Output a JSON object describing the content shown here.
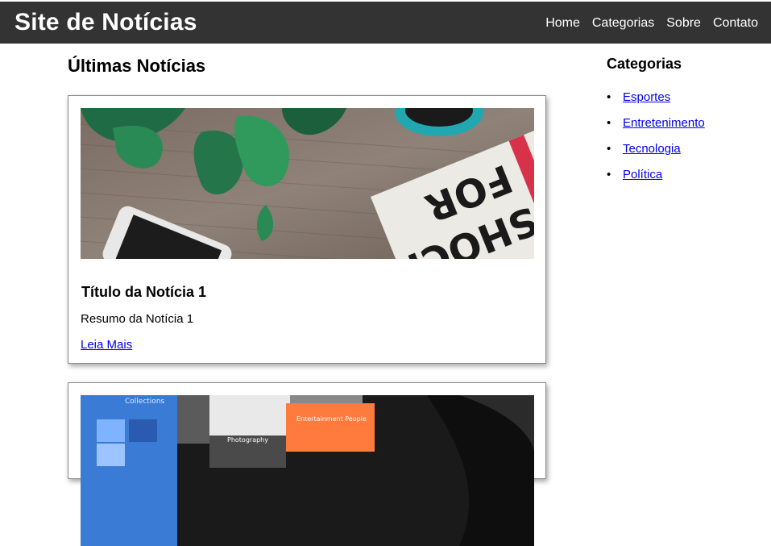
{
  "header": {
    "site_title": "Site de Notícias",
    "nav": [
      {
        "label": "Home"
      },
      {
        "label": "Categorias"
      },
      {
        "label": "Sobre"
      },
      {
        "label": "Contato"
      }
    ]
  },
  "main": {
    "heading": "Últimas Notícias",
    "articles": [
      {
        "title": "Título da Notícia 1",
        "summary": "Resumo da Notícia 1",
        "link_label": "Leia Mais"
      }
    ],
    "photo1_text": {
      "line1": "FOR",
      "line2": "SHOCK"
    },
    "photo2_text": {
      "label1": "Collections",
      "label2": "Photography",
      "label3": "Entertainment People"
    }
  },
  "sidebar": {
    "heading": "Categorias",
    "items": [
      {
        "label": "Esportes"
      },
      {
        "label": "Entretenimento"
      },
      {
        "label": "Tecnologia"
      },
      {
        "label": "Política"
      }
    ]
  },
  "colors": {
    "header_bg": "#333333",
    "link": "#0000ee"
  }
}
